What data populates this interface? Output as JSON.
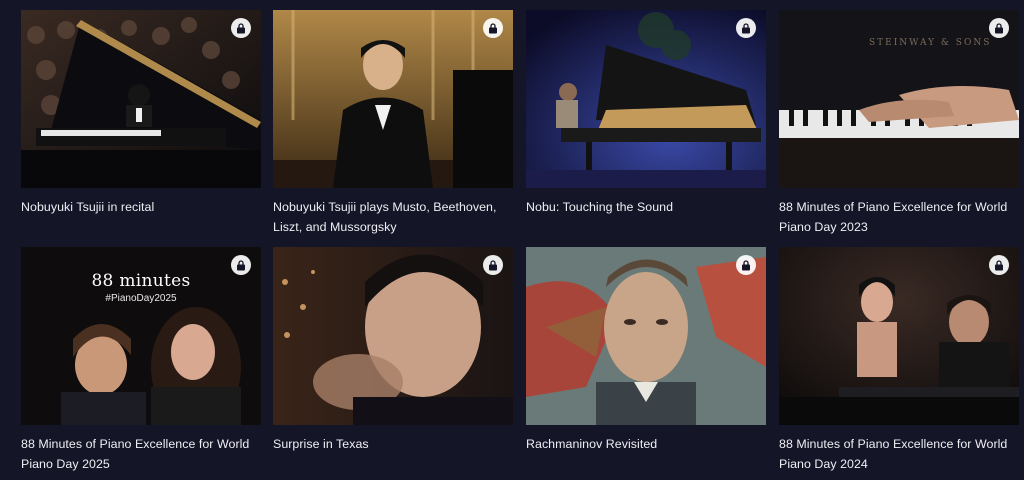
{
  "cards": [
    {
      "title": "Nobuyuki Tsujii in recital",
      "icon": "lock-icon",
      "image": "pianist-at-grand-piano-with-audience"
    },
    {
      "title": "Nobuyuki Tsujii plays Musto, Beethoven, Liszt, and Mussorgsky",
      "icon": "lock-icon",
      "image": "pianist-in-tuxedo-on-golden-stage"
    },
    {
      "title": "Nobu: Touching the Sound",
      "icon": "lock-icon",
      "image": "grand-piano-on-blue-lit-stage"
    },
    {
      "title": "88 Minutes of Piano Excellence for World Piano Day 2023",
      "icon": "lock-icon",
      "image": "hands-on-steinway-keyboard"
    },
    {
      "title": "88 Minutes of Piano Excellence for World Piano Day 2025",
      "icon": "lock-icon",
      "image": "two-pianists-promo",
      "overlay_title": "88 minutes",
      "overlay_tag": "#PianoDay2025"
    },
    {
      "title": "Surprise in Texas",
      "icon": "lock-icon",
      "image": "pianist-closeup-superimposed"
    },
    {
      "title": "Rachmaninov Revisited",
      "icon": "lock-icon",
      "image": "rachmaninov-portrait-painting"
    },
    {
      "title": "88 Minutes of Piano Excellence for World Piano Day 2024",
      "icon": "lock-icon",
      "image": "two-pianists-dark-stage"
    }
  ]
}
